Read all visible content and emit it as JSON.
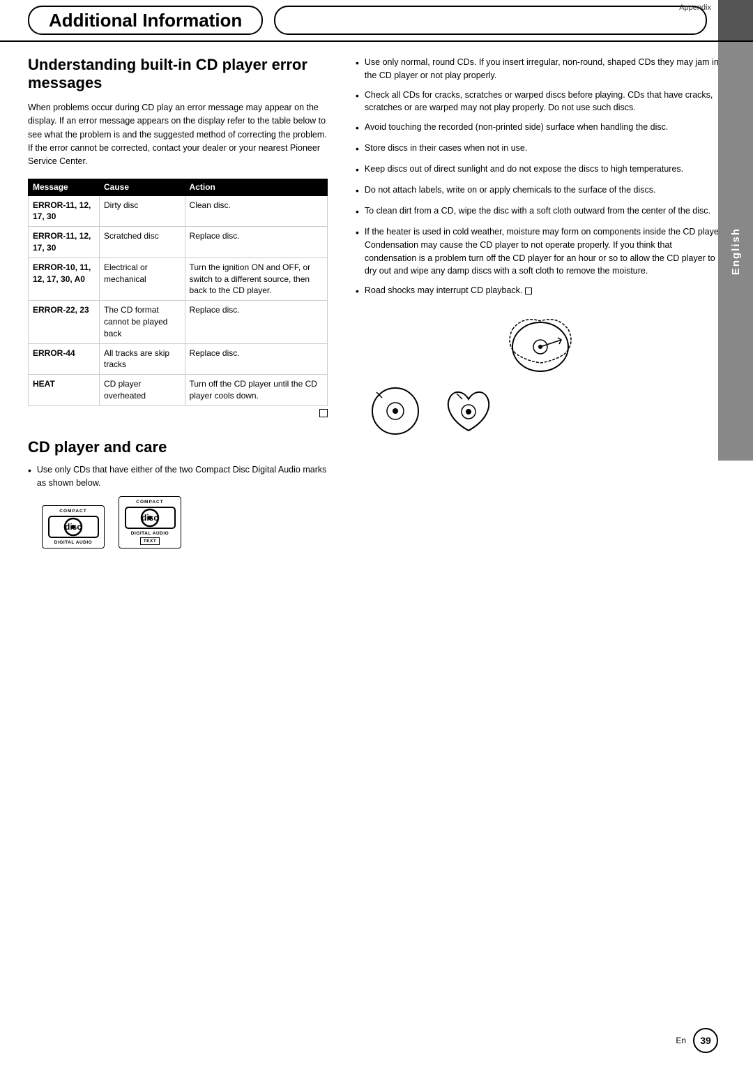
{
  "header": {
    "title": "Additional Information",
    "appendix_label": "Appendix",
    "middle_box": "",
    "right_box": ""
  },
  "english_sidebar": "English",
  "section1": {
    "title": "Understanding built-in CD player error messages",
    "body": "When problems occur during CD play an error message may appear on the display. If an error message appears on the display refer to the table below to see what the problem is and the suggested method of correcting the problem. If the error cannot be corrected, contact your dealer or your nearest Pioneer Service Center.",
    "table": {
      "headers": [
        "Message",
        "Cause",
        "Action"
      ],
      "rows": [
        {
          "message": "ERROR-11, 12, 17, 30",
          "cause": "Dirty disc",
          "action": "Clean disc."
        },
        {
          "message": "ERROR-11, 12, 17, 30",
          "cause": "Scratched disc",
          "action": "Replace disc."
        },
        {
          "message": "ERROR-10, 11, 12, 17, 30, A0",
          "cause": "Electrical or mechanical",
          "action": "Turn the ignition ON and OFF, or switch to a different source, then back to the CD player."
        },
        {
          "message": "ERROR-22, 23",
          "cause": "The CD format cannot be played back",
          "action": "Replace disc."
        },
        {
          "message": "ERROR-44",
          "cause": "All tracks are skip tracks",
          "action": "Replace disc."
        },
        {
          "message": "HEAT",
          "cause": "CD player overheated",
          "action": "Turn off the CD player until the CD player cools down."
        }
      ]
    }
  },
  "section2": {
    "title": "CD player and care",
    "intro": "Use only CDs that have either of the two Compact Disc Digital Audio marks as shown below.",
    "bullets": [
      "Use only normal, round CDs. If you insert irregular, non-round, shaped CDs they may jam in the CD player or not play properly.",
      "Check all CDs for cracks, scratches or warped discs before playing. CDs that have cracks, scratches or are warped may not play properly. Do not use such discs.",
      "Avoid touching the recorded (non-printed side) surface when handling the disc.",
      "Store discs in their cases when not in use.",
      "Keep discs out of direct sunlight and do not expose the discs to high temperatures.",
      "Do not attach labels, write on or apply chemicals to the surface of the discs.",
      "To clean dirt from a CD, wipe the disc with a soft cloth outward from the center of the disc.",
      "If the heater is used in cold weather, moisture may form on components inside the CD player. Condensation may cause the CD player to not operate properly. If you think that condensation is a problem turn off the CD player for an hour or so to allow the CD player to dry out and wipe any damp discs with a soft cloth to remove the moisture.",
      "Road shocks may interrupt CD playback."
    ]
  },
  "footer": {
    "en_label": "En",
    "page_number": "39"
  }
}
